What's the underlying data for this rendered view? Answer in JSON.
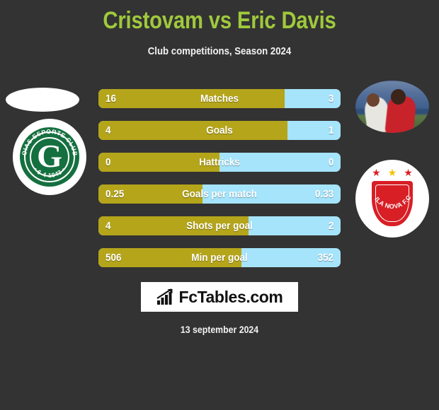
{
  "header": {
    "title": "Cristovam vs Eric Davis",
    "subtitle": "Club competitions, Season 2024",
    "title_color": "#9fc93c"
  },
  "theme": {
    "background": "#333333",
    "home_color": "#b5a51a",
    "away_color": "#a5e4fb",
    "text_color": "#ffffff"
  },
  "players": {
    "home": {
      "name": "Cristovam",
      "photo": "player-photo-placeholder",
      "club": "Goias Esporte Clube",
      "crest": {
        "letter": "G",
        "arc_top": "GOIAS ESPORTE CLUBE",
        "arc_bottom": "• 6-4-1943 •",
        "color": "#15703f"
      }
    },
    "away": {
      "name": "Eric Davis",
      "photo": "player-photo",
      "club": "Vila Nova F.C.",
      "crest": {
        "band_text": "VILA NOVA F.C.",
        "color": "#d81f26",
        "star_center_color": "#f2c200",
        "star_side_color": "#d81f26"
      }
    }
  },
  "chart_data": {
    "type": "bar",
    "title": "Cristovam vs Eric Davis",
    "subtitle": "Club competitions, Season 2024",
    "orientation": "horizontal-diverging",
    "legend": [
      "Cristovam",
      "Eric Davis"
    ],
    "categories": [
      "Matches",
      "Goals",
      "Hattricks",
      "Goals per match",
      "Shots per goal",
      "Min per goal"
    ],
    "series": [
      {
        "name": "Cristovam",
        "values": [
          16,
          4,
          0,
          0.25,
          4,
          506
        ],
        "color": "#b5a51a"
      },
      {
        "name": "Eric Davis",
        "values": [
          3,
          1,
          0,
          0.33,
          2,
          352
        ],
        "color": "#a5e4fb"
      }
    ],
    "rows": [
      {
        "label": "Matches",
        "home": "16",
        "away": "3",
        "home_pct": 77
      },
      {
        "label": "Goals",
        "home": "4",
        "away": "1",
        "home_pct": 78
      },
      {
        "label": "Hattricks",
        "home": "0",
        "away": "0",
        "home_pct": 50
      },
      {
        "label": "Goals per match",
        "home": "0.25",
        "away": "0.33",
        "home_pct": 43
      },
      {
        "label": "Shots per goal",
        "home": "4",
        "away": "2",
        "home_pct": 62
      },
      {
        "label": "Min per goal",
        "home": "506",
        "away": "352",
        "home_pct": 59
      }
    ]
  },
  "footer": {
    "logo_text": "FcTables.com",
    "logo_icon": "bar-chart-growth-icon",
    "date": "13 september 2024"
  }
}
